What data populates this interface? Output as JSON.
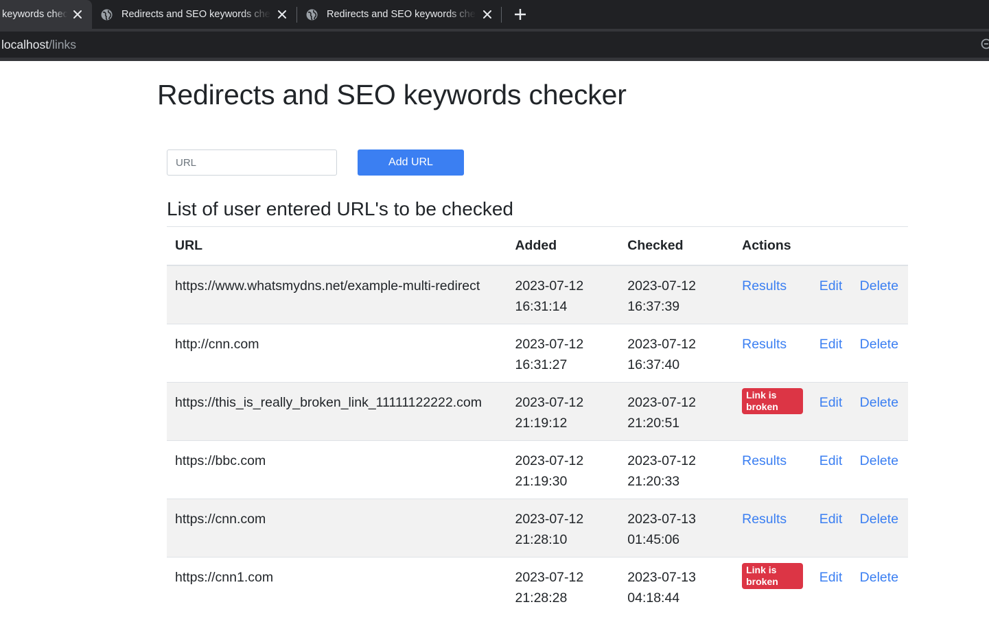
{
  "browser": {
    "tabs": [
      {
        "title": "keywords chec",
        "active": true
      },
      {
        "title": "Redirects and SEO keywords chec",
        "active": false
      },
      {
        "title": "Redirects and SEO keywords chec",
        "active": false
      }
    ],
    "address": {
      "host": "localhost",
      "path": "/links"
    }
  },
  "page": {
    "title": "Redirects and SEO keywords checker",
    "form": {
      "url_placeholder": "URL",
      "url_value": "",
      "add_button": "Add URL"
    },
    "list_heading": "List of user entered URL's to be checked",
    "table": {
      "headers": {
        "url": "URL",
        "added": "Added",
        "checked": "Checked",
        "actions": "Actions"
      },
      "rows": [
        {
          "url": "https://www.whatsmydns.net/example-multi-redirect",
          "added_date": "2023-07-12",
          "added_time": "16:31:14",
          "checked_date": "2023-07-12",
          "checked_time": "16:37:39",
          "result": "Results",
          "edit": "Edit",
          "delete": "Delete"
        },
        {
          "url": "http://cnn.com",
          "added_date": "2023-07-12",
          "added_time": "16:31:27",
          "checked_date": "2023-07-12",
          "checked_time": "16:37:40",
          "result": "Results",
          "edit": "Edit",
          "delete": "Delete"
        },
        {
          "url": "https://this_is_really_broken_link_11111122222.com",
          "added_date": "2023-07-12",
          "added_time": "21:19:12",
          "checked_date": "2023-07-12",
          "checked_time": "21:20:51",
          "broken": "Link is broken",
          "edit": "Edit",
          "delete": "Delete"
        },
        {
          "url": "https://bbc.com",
          "added_date": "2023-07-12",
          "added_time": "21:19:30",
          "checked_date": "2023-07-12",
          "checked_time": "21:20:33",
          "result": "Results",
          "edit": "Edit",
          "delete": "Delete"
        },
        {
          "url": "https://cnn.com",
          "added_date": "2023-07-12",
          "added_time": "21:28:10",
          "checked_date": "2023-07-13",
          "checked_time": "01:45:06",
          "result": "Results",
          "edit": "Edit",
          "delete": "Delete"
        },
        {
          "url": "https://cnn1.com",
          "added_date": "2023-07-12",
          "added_time": "21:28:28",
          "checked_date": "2023-07-13",
          "checked_time": "04:18:44",
          "broken": "Link is broken",
          "edit": "Edit",
          "delete": "Delete"
        }
      ]
    }
  },
  "colors": {
    "link": "#3b7ff2",
    "button": "#3b7ff2",
    "danger_badge": "#dc3545",
    "stripe": "#f2f2f2"
  },
  "icons": {
    "tab_favicon": "globe-icon",
    "tab_close": "close-icon",
    "new_tab": "plus-icon",
    "omnibox_right": "zoom-icon"
  }
}
